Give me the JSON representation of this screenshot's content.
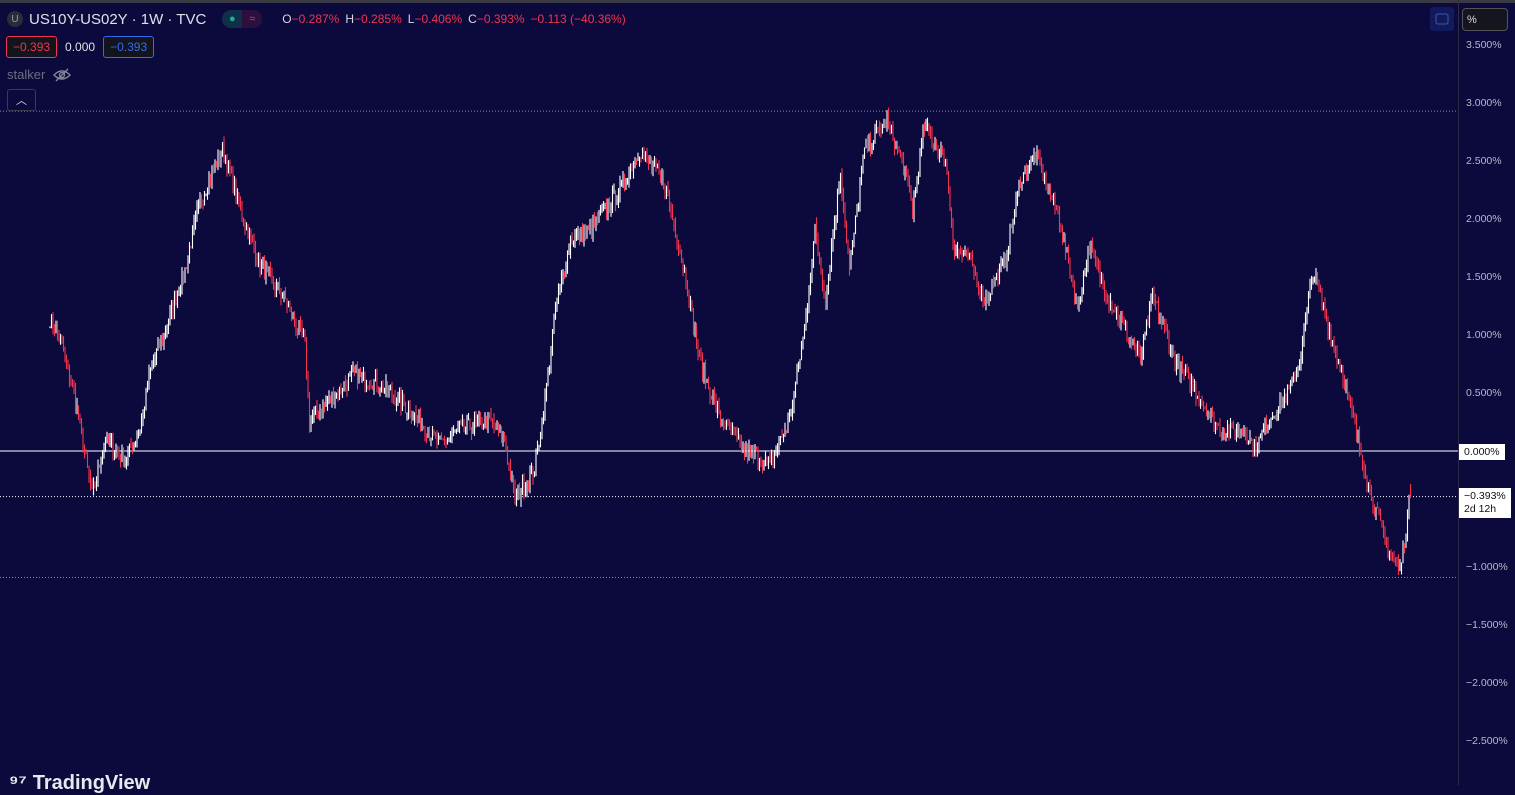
{
  "header": {
    "symbol_badge": "U",
    "title": "US10Y-US02Y · 1W · TVC",
    "ohlc": {
      "o_label": "O",
      "o": "−0.287%",
      "h_label": "H",
      "h": "−0.285%",
      "l_label": "L",
      "l": "−0.406%",
      "c_label": "C",
      "c": "−0.393%",
      "change": "−0.113 (−40.36%)"
    },
    "bid": "−0.393",
    "spread": "0.000",
    "ask": "−0.393",
    "indicator_name": "stalker",
    "unit_button": "%"
  },
  "axis": {
    "current_label": "−0.393%",
    "countdown": "2d 12h",
    "zero_label": "0.000%"
  },
  "logo_text": "TradingView",
  "colors": {
    "background": "#0c0a3d",
    "up": "#ffffff",
    "down": "#f2344e"
  },
  "chart_data": {
    "type": "candlestick",
    "title": "US10Y-US02Y · 1W · TVC",
    "y_unit": "%",
    "ylim": [
      -2.88,
      3.88
    ],
    "yticks": [
      3.5,
      3.0,
      2.5,
      2.0,
      1.5,
      1.0,
      0.5,
      0.0,
      -0.393,
      -1.0,
      -1.5,
      -2.0,
      -2.5
    ],
    "ytick_labels": [
      "3.500%",
      "3.000%",
      "2.500%",
      "2.000%",
      "1.500%",
      "1.000%",
      "0.500%",
      "0.000%",
      "−0.393%",
      "−1.000%",
      "−1.500%",
      "−2.000%",
      "−2.500%"
    ],
    "reference_lines": {
      "zero": 0.0,
      "last": -0.393,
      "high": 2.93,
      "low": -1.09
    },
    "bars_total": 908,
    "close_path_anchors": [
      [
        0,
        1.13
      ],
      [
        7,
        0.96
      ],
      [
        17,
        0.44
      ],
      [
        28,
        -0.38
      ],
      [
        37,
        0.1
      ],
      [
        50,
        -0.08
      ],
      [
        60,
        0.18
      ],
      [
        67,
        0.7
      ],
      [
        77,
        1.04
      ],
      [
        90,
        1.56
      ],
      [
        100,
        2.16
      ],
      [
        115,
        2.6
      ],
      [
        127,
        2.08
      ],
      [
        140,
        1.6
      ],
      [
        157,
        1.3
      ],
      [
        170,
        0.91
      ],
      [
        173,
        0.27
      ],
      [
        187,
        0.44
      ],
      [
        203,
        0.66
      ],
      [
        220,
        0.57
      ],
      [
        240,
        0.35
      ],
      [
        260,
        0.05
      ],
      [
        273,
        0.18
      ],
      [
        293,
        0.27
      ],
      [
        303,
        0.09
      ],
      [
        310,
        -0.42
      ],
      [
        323,
        -0.16
      ],
      [
        330,
        0.44
      ],
      [
        337,
        1.22
      ],
      [
        347,
        1.82
      ],
      [
        360,
        1.9
      ],
      [
        380,
        2.25
      ],
      [
        393,
        2.6
      ],
      [
        410,
        2.29
      ],
      [
        423,
        1.56
      ],
      [
        433,
        0.78
      ],
      [
        447,
        0.27
      ],
      [
        463,
        0.01
      ],
      [
        480,
        -0.12
      ],
      [
        493,
        0.27
      ],
      [
        503,
        1.04
      ],
      [
        510,
        1.9
      ],
      [
        517,
        1.3
      ],
      [
        527,
        2.42
      ],
      [
        533,
        1.56
      ],
      [
        543,
        2.6
      ],
      [
        558,
        2.85
      ],
      [
        570,
        2.42
      ],
      [
        575,
        2.08
      ],
      [
        583,
        2.8
      ],
      [
        597,
        2.5
      ],
      [
        603,
        1.73
      ],
      [
        613,
        1.65
      ],
      [
        623,
        1.3
      ],
      [
        637,
        1.65
      ],
      [
        647,
        2.34
      ],
      [
        657,
        2.55
      ],
      [
        673,
        2.0
      ],
      [
        685,
        1.22
      ],
      [
        693,
        1.78
      ],
      [
        703,
        1.39
      ],
      [
        717,
        1.04
      ],
      [
        727,
        0.78
      ],
      [
        735,
        1.34
      ],
      [
        750,
        0.78
      ],
      [
        763,
        0.53
      ],
      [
        780,
        0.18
      ],
      [
        797,
        0.18
      ],
      [
        803,
        0.01
      ],
      [
        813,
        0.27
      ],
      [
        827,
        0.53
      ],
      [
        833,
        0.78
      ],
      [
        842,
        1.56
      ],
      [
        853,
        1.04
      ],
      [
        863,
        0.61
      ],
      [
        872,
        0.09
      ],
      [
        880,
        -0.34
      ],
      [
        890,
        -0.77
      ],
      [
        900,
        -1.03
      ],
      [
        907,
        -0.393
      ]
    ],
    "last_bar": {
      "open": -0.287,
      "high": -0.285,
      "low": -0.406,
      "close": -0.393
    }
  }
}
